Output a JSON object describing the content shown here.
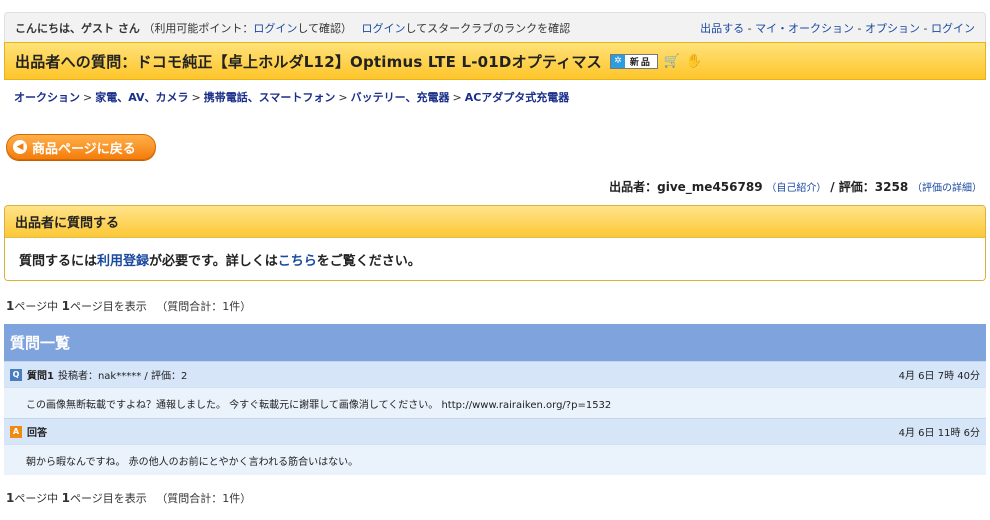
{
  "topbar": {
    "greeting": "こんにちは、",
    "guest": "ゲスト さん",
    "points_prefix": "（利用可能ポイント：",
    "points_login": "ログイン",
    "points_suffix": "して確認）",
    "star_login": "ログイン",
    "star_text": "してスタークラブのランクを確認",
    "nav": [
      "出品する",
      "マイ・オークション",
      "オプション",
      "ログイン"
    ],
    "nav_sep": " - "
  },
  "title": {
    "text": "出品者への質問：ドコモ純正【卓上ホルダL12】Optimus LTE L-01Dオプティマス",
    "badge": "新品"
  },
  "breadcrumb": [
    "オークション",
    "家電、AV、カメラ",
    "携帯電話、スマートフォン",
    "バッテリー、充電器",
    "ACアダプタ式充電器"
  ],
  "back_button": "商品ページに戻る",
  "seller": {
    "label": "出品者：",
    "id": "give_me456789",
    "intro": "（自己紹介）",
    "rating_label": "/ 評価：",
    "rating": "3258",
    "rating_detail": "（評価の詳細）"
  },
  "ask": {
    "header": "出品者に質問する",
    "body_pre": "質問するには",
    "body_link1": "利用登録",
    "body_mid": "が必要です。詳しくは",
    "body_link2": "こちら",
    "body_post": "をご覧ください。"
  },
  "pagination": {
    "total_pages": "1",
    "total_text": "ページ中",
    "current_page": "1",
    "current_text": "ページ目を表示",
    "count_text": "（質問合計：1件）"
  },
  "qlist": {
    "header": "質問一覧",
    "question": {
      "icon": "Q",
      "label": "質問1",
      "meta": "投稿者：nak***** / 評価：2",
      "time": "4月 6日 7時 40分",
      "body": "この画像無断転載ですよね？通報しました。 今すぐ転載元に謝罪して画像消してください。 http://www.rairaiken.org/?p=1532"
    },
    "answer": {
      "icon": "A",
      "label": "回答",
      "time": "4月 6日 11時 6分",
      "body": "朝から暇なんですね。 赤の他人のお前にとやかく言われる筋合いはない。"
    }
  }
}
